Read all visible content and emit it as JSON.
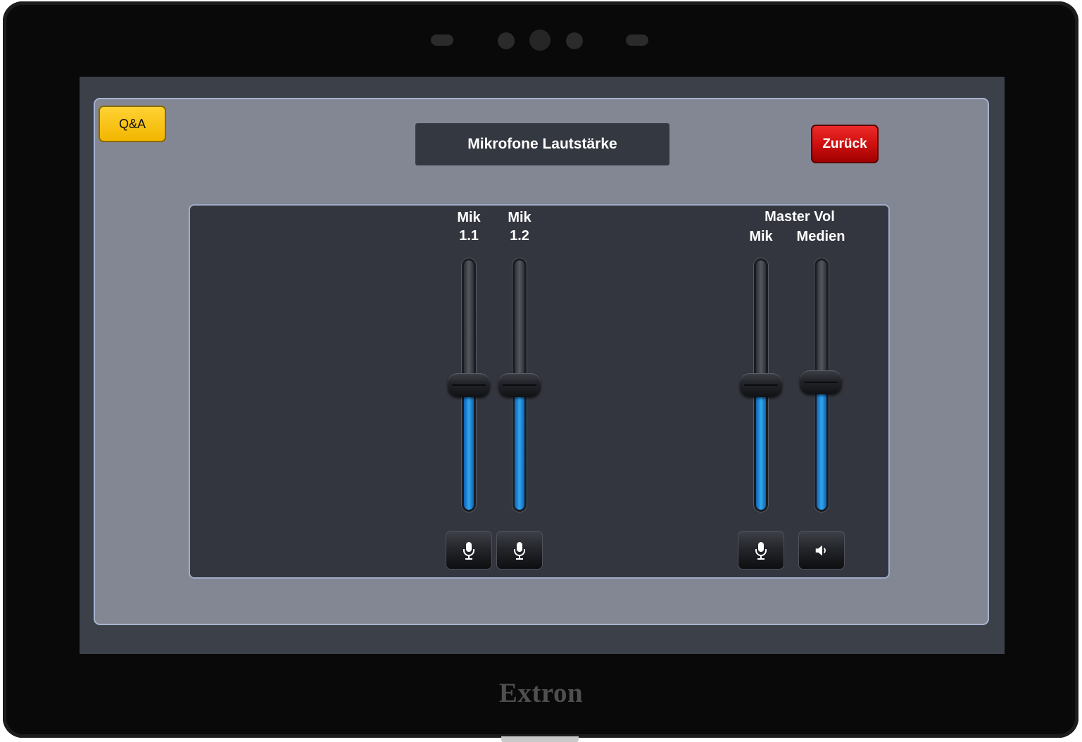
{
  "device": {
    "brand": "Extron"
  },
  "header": {
    "qa_label": "Q&A",
    "title": "Mikrofone Lautstärke",
    "back_label": "Zurück"
  },
  "mixer": {
    "master_label": "Master Vol",
    "channels": [
      {
        "label_line1": "Mik",
        "label_line2": "1.1",
        "level_percent": 50,
        "mute_icon": "microphone-icon"
      },
      {
        "label_line1": "Mik",
        "label_line2": "1.2",
        "level_percent": 50,
        "mute_icon": "microphone-icon"
      },
      {
        "label_line1": "",
        "label_line2": "Mik",
        "level_percent": 50,
        "mute_icon": "microphone-icon"
      },
      {
        "label_line1": "",
        "label_line2": "Medien",
        "level_percent": 51,
        "mute_icon": "speaker-icon"
      }
    ]
  },
  "colors": {
    "qa_button": "#f5bd00",
    "back_button": "#d01010",
    "level_fill": "#1e8fe0",
    "panel_border": "#a8b4cf"
  }
}
